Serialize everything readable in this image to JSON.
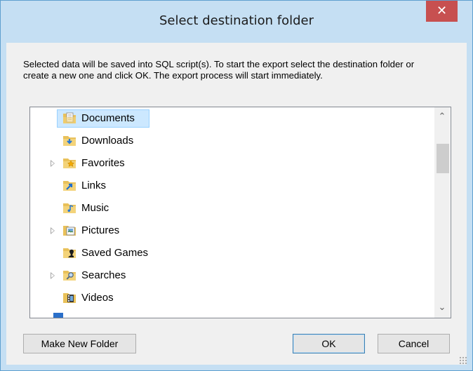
{
  "window": {
    "title": "Select destination folder",
    "close_glyph": "✕",
    "description": "Selected data will be saved into SQL script(s). To start the export select the destination folder or create a new one and click OK. The export process will start immediately."
  },
  "tree": {
    "selected": "Documents",
    "items": [
      {
        "label": "Documents",
        "icon": "documents-folder-icon",
        "expandable": false
      },
      {
        "label": "Downloads",
        "icon": "downloads-folder-icon",
        "expandable": false
      },
      {
        "label": "Favorites",
        "icon": "favorites-folder-icon",
        "expandable": true
      },
      {
        "label": "Links",
        "icon": "links-folder-icon",
        "expandable": false
      },
      {
        "label": "Music",
        "icon": "music-folder-icon",
        "expandable": false
      },
      {
        "label": "Pictures",
        "icon": "pictures-folder-icon",
        "expandable": true
      },
      {
        "label": "Saved Games",
        "icon": "saved-games-folder-icon",
        "expandable": false
      },
      {
        "label": "Searches",
        "icon": "searches-folder-icon",
        "expandable": true
      },
      {
        "label": "Videos",
        "icon": "videos-folder-icon",
        "expandable": false
      }
    ],
    "scroll_up_glyph": "⌃",
    "scroll_down_glyph": "⌄"
  },
  "buttons": {
    "make_new_folder": "Make New Folder",
    "ok": "OK",
    "cancel": "Cancel"
  },
  "colors": {
    "title_bar": "#c5dff3",
    "close_button": "#c75050",
    "selection": "#cce8ff"
  }
}
